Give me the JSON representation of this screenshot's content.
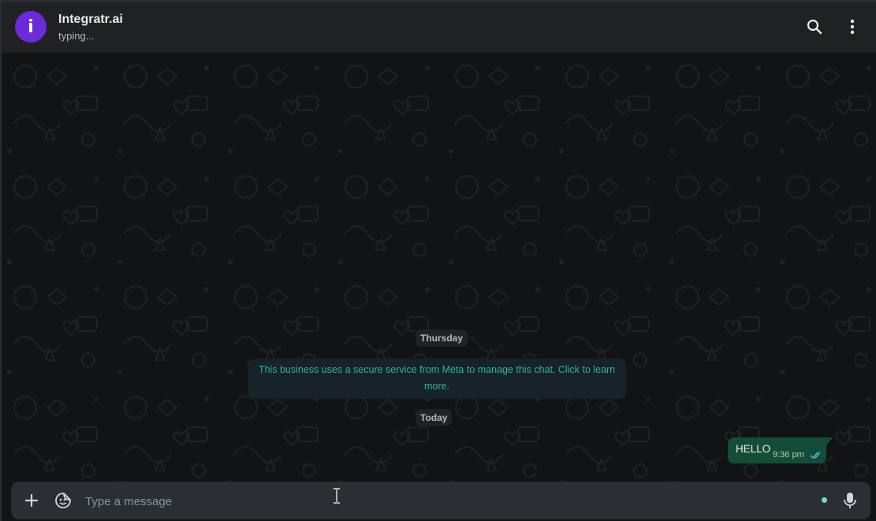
{
  "header": {
    "avatar_letter": "i",
    "title": "Integratr.ai",
    "status": "typing...",
    "icons": [
      "search-icon",
      "menu-icon"
    ]
  },
  "chat": {
    "date_separators": [
      "Thursday",
      "Today"
    ],
    "system_message": "This business uses a secure service from Meta to manage this chat. Click to learn more.",
    "messages": [
      {
        "text": "HELLO",
        "time": "9:36 pm",
        "status": "read",
        "direction": "outgoing"
      }
    ]
  },
  "composer": {
    "placeholder": "Type a message",
    "icons": [
      "plus-icon",
      "sticker-icon",
      "mic-icon"
    ]
  },
  "colors": {
    "accent": "#26b79d",
    "avatar_bg": "#6b2bd9",
    "outgoing_bubble": "#144d37",
    "read_ticks": "#53bdeb"
  }
}
